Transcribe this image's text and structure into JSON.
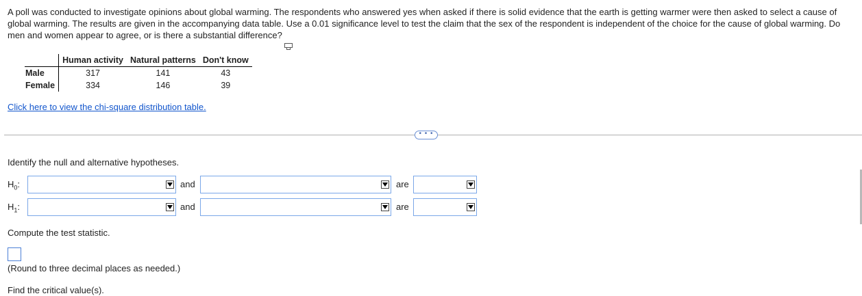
{
  "problem_text": "A poll was conducted to investigate opinions about global warming. The respondents who answered yes when asked if there is solid evidence that the earth is getting warmer were then asked to select a cause of global warming. The results are given in the accompanying data table. Use a 0.01 significance level to test the claim that the sex of the respondent is independent of the choice for the cause of global warming. Do men and women appear to agree, or is there a substantial difference?",
  "table": {
    "columns": [
      "Human activity",
      "Natural patterns",
      "Don't know"
    ],
    "rows": [
      {
        "label": "Male",
        "values": [
          "317",
          "141",
          "43"
        ]
      },
      {
        "label": "Female",
        "values": [
          "334",
          "146",
          "39"
        ]
      }
    ]
  },
  "link_text": "Click here to view the chi-square distribution table.",
  "more_text": "• • •",
  "hypotheses": {
    "prompt": "Identify the null and alternative hypotheses.",
    "h0_label": "H",
    "h0_sub": "0",
    "h1_label": "H",
    "h1_sub": "1",
    "and": "and",
    "are": "are"
  },
  "test_statistic": {
    "prompt": "Compute the test statistic.",
    "hint": "(Round to three decimal places as needed.)"
  },
  "next_prompt_partial": "Find the critical value(s)."
}
